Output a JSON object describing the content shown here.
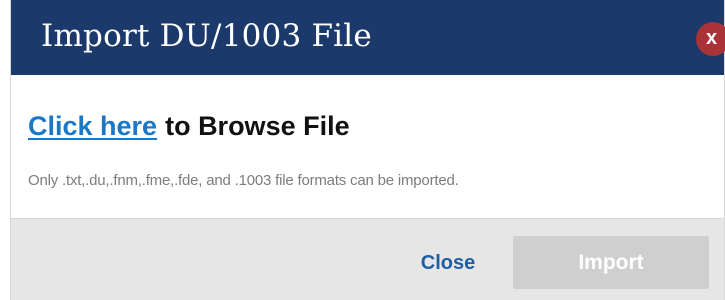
{
  "dialog": {
    "title": "Import DU/1003 File",
    "close_icon_glyph": "x",
    "close_icon_name": "close-icon",
    "header_color": "#1b3a6b",
    "close_icon_color": "#a93336"
  },
  "body": {
    "browse_link": "Click here",
    "browse_text": "to Browse File",
    "hint": "Only .txt,.du,.fnm,.fme,.fde, and .1003 file formats can be imported.",
    "link_color": "#1a78c6"
  },
  "footer": {
    "close_label": "Close",
    "import_label": "Import",
    "import_state": "disabled"
  }
}
